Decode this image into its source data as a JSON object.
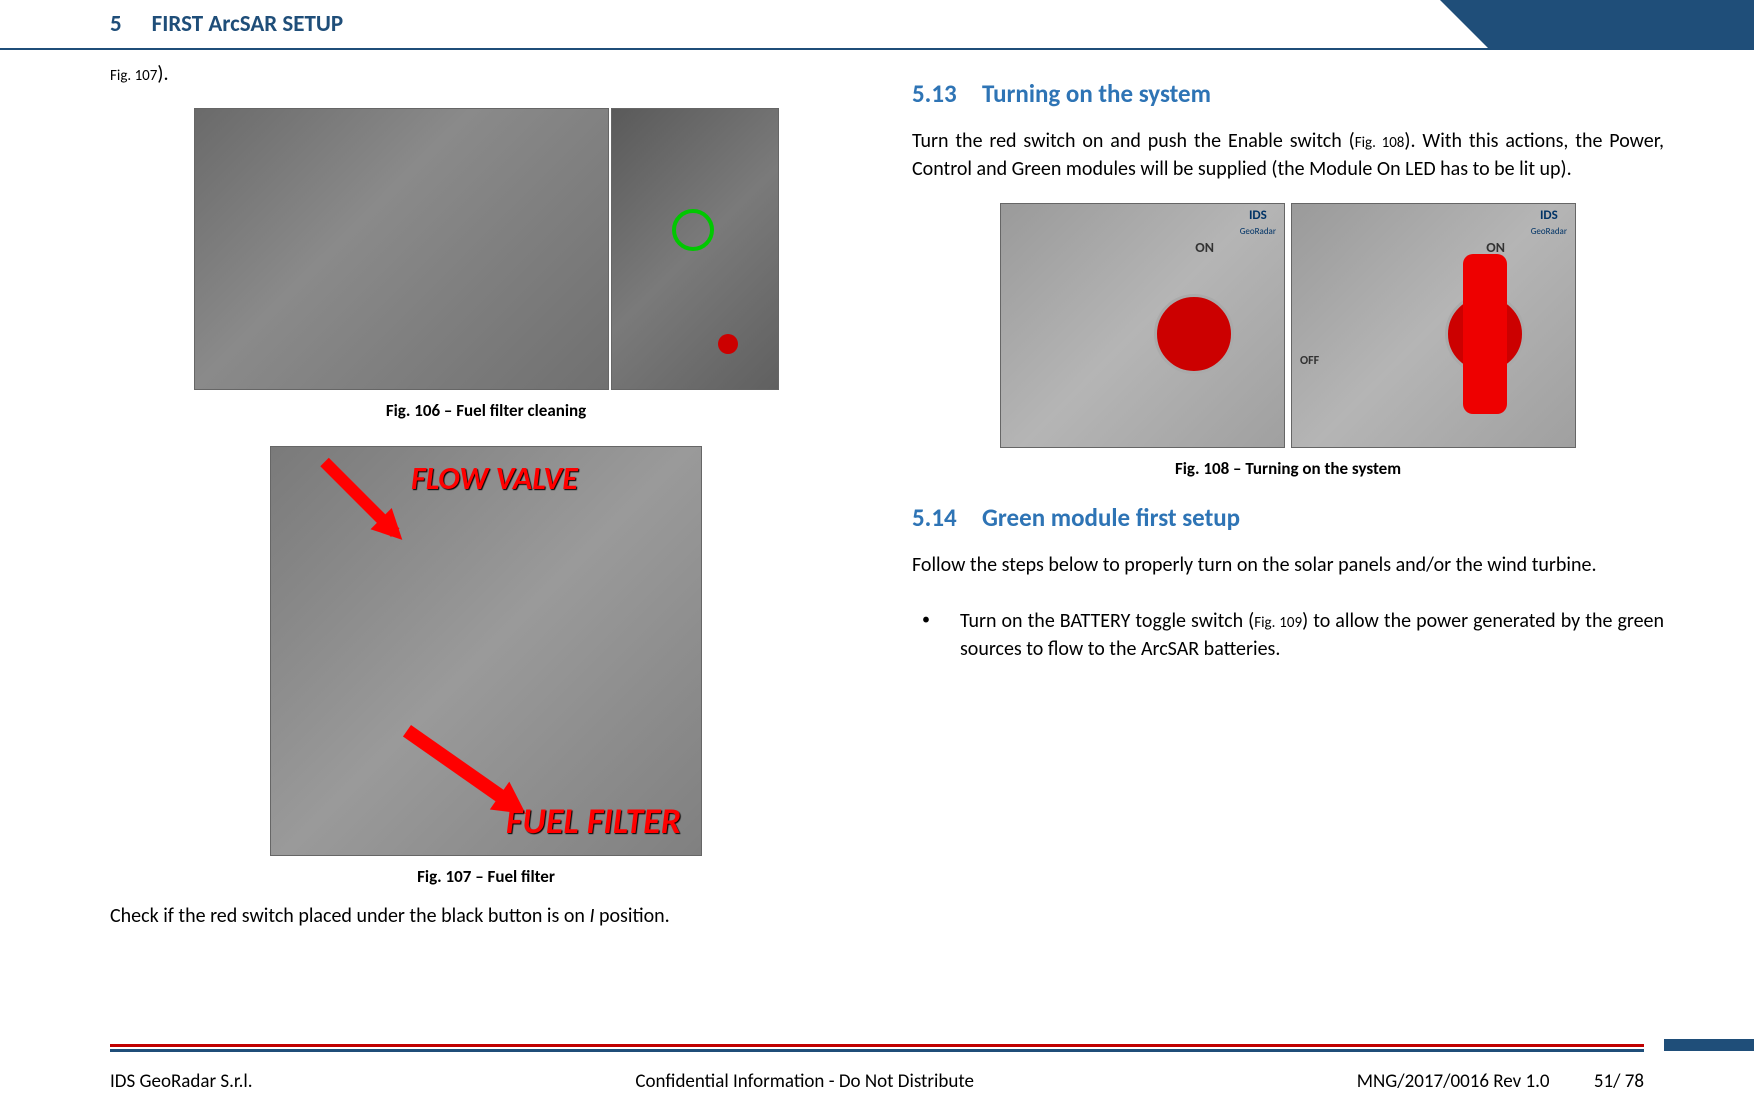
{
  "header": {
    "chapter_number": "5",
    "chapter_title": "FIRST ArcSAR SETUP"
  },
  "left_column": {
    "top_ref": "Fig. 107",
    "top_ref_suffix": ").",
    "fig106_caption": "Fig. 106 – Fuel filter cleaning",
    "fig107_flow_valve": "FLOW VALVE",
    "fig107_fuel_filter": "FUEL FILTER",
    "fig107_caption": "Fig. 107 – Fuel filter",
    "bottom_text_pre": "Check if the red switch placed under the black button is on ",
    "bottom_text_italic": "I",
    "bottom_text_post": " position."
  },
  "right_column": {
    "sec513_num": "5.13",
    "sec513_title": "Turning on the system",
    "sec513_body_pre": "Turn the red switch on and push the Enable switch (",
    "sec513_body_ref": "Fig. 108",
    "sec513_body_post": "). With this actions, the Power, Control and Green modules will be supplied (the Module On LED has to be lit up).",
    "fig108_ids": "IDS",
    "fig108_georadar": "GeoRadar",
    "fig108_on": "ON",
    "fig108_off": "OFF",
    "fig108_caption": "Fig. 108 – Turning on the system",
    "sec514_num": "5.14",
    "sec514_title": "Green module first setup",
    "sec514_body": "Follow the steps below to properly turn on the solar panels and/or the wind turbine.",
    "bullet1_pre": "Turn on the BATTERY toggle switch (",
    "bullet1_ref": "Fig. 109",
    "bullet1_post": ") to allow the power generated by the green sources to flow to the ArcSAR batteries."
  },
  "footer": {
    "company": "IDS GeoRadar S.r.l.",
    "confidential": "Confidential Information - Do Not Distribute",
    "docref": "MNG/2017/0016  Rev 1.0",
    "page": "51/ 78"
  }
}
